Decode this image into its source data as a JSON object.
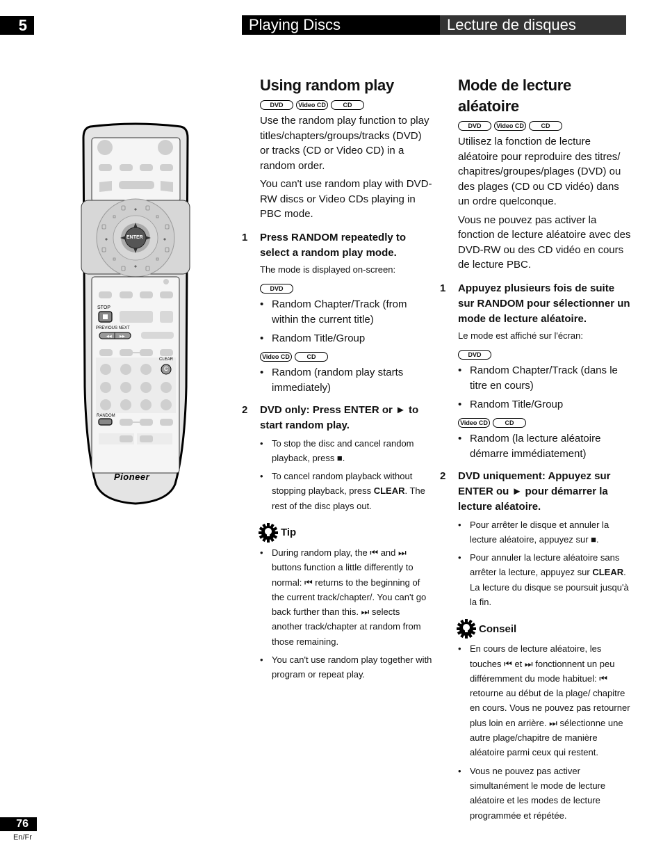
{
  "header": {
    "chapter_number": "5",
    "title_en": "Playing Discs",
    "title_fr": "Lecture de disques"
  },
  "footer": {
    "page_number": "76",
    "language": "En/Fr"
  },
  "remote": {
    "brand": "Pioneer",
    "enter_label": "ENTER",
    "stop_label": "STOP",
    "previous_next_label": "PREVIOUS NEXT",
    "clear_label": "CLEAR",
    "clear_glyph": "C",
    "random_label": "RANDOM"
  },
  "english": {
    "title": "Using random play",
    "badges": [
      "DVD",
      "Video CD",
      "CD"
    ],
    "intro": "Use the random play function to play titles/chapters/groups/tracks (DVD) or tracks (CD or  Video CD) in a random order.",
    "note": "You can't use random play with DVD-RW discs or Video CDs playing in PBC mode.",
    "step1": {
      "number": "1",
      "title": "Press RANDOM repeatedly to select a random play mode.",
      "sub": "The mode is displayed on-screen:",
      "dvd_badge": "DVD",
      "dvd_items": [
        "Random Chapter/Track (from within the current title)",
        "Random Title/Group"
      ],
      "vcd_badges": [
        "Video CD",
        "CD"
      ],
      "vcd_items": [
        "Random (random play starts immediately)"
      ]
    },
    "step2": {
      "number": "2",
      "title": "DVD only: Press ENTER or ► to start random play.",
      "items": [
        "To stop the disc and cancel random playback, press ■.",
        {
          "before": "To cancel random playback without stopping playback, press ",
          "key": "CLEAR",
          "after": ". The rest of the disc plays out."
        }
      ]
    },
    "tip": {
      "label": "Tip",
      "items": [
        "During random play, the ⏮ and ⏭ buttons function a little differently to normal: ⏮ returns to the beginning of the current track/chapter/. You can't go back further than this. ⏭ selects another track/chapter at random from those remaining.",
        "You can't use random play together with program or repeat play."
      ]
    }
  },
  "french": {
    "title": "Mode de lecture aléatoire",
    "badges": [
      "DVD",
      "Video CD",
      "CD"
    ],
    "intro": "Utilisez la fonction de lecture aléatoire pour reproduire des titres/ chapitres/groupes/plages (DVD) ou des plages (CD ou CD vidéo) dans un ordre quelconque.",
    "note": "Vous ne pouvez pas activer la fonction de lecture aléatoire avec des DVD-RW ou des CD vidéo en cours de lecture PBC.",
    "step1": {
      "number": "1",
      "title": "Appuyez plusieurs fois de suite sur RANDOM pour sélectionner un mode de lecture aléatoire.",
      "sub": "Le mode est affiché sur l'écran:",
      "dvd_badge": "DVD",
      "dvd_items": [
        "Random Chapter/Track (dans le titre en cours)",
        "Random Title/Group"
      ],
      "vcd_badges": [
        "Video CD",
        "CD"
      ],
      "vcd_items": [
        "Random (la lecture aléatoire démarre immédiatement)"
      ]
    },
    "step2": {
      "number": "2",
      "title": "DVD uniquement: Appuyez sur ENTER ou ► pour démarrer la lecture aléatoire.",
      "items": [
        "Pour arrêter le disque et annuler la lecture aléatoire, appuyez sur ■.",
        {
          "before": "Pour annuler la lecture aléatoire sans arrêter la lecture, appuyez sur ",
          "key": "CLEAR",
          "after": ". La lecture du disque se poursuit jusqu'à la fin."
        }
      ]
    },
    "tip": {
      "label": "Conseil",
      "items": [
        "En cours de lecture aléatoire, les touches ⏮ et ⏭ fonctionnent un peu différemment du mode habituel: ⏮ retourne au début de la plage/ chapitre en cours. Vous ne pouvez pas retourner plus loin en arrière. ⏭ sélectionne une autre plage/chapitre de manière aléatoire parmi ceux qui restent.",
        "Vous ne pouvez pas activer simultanément le mode de lecture aléatoire et les modes de lecture programmée et répétée."
      ]
    }
  }
}
